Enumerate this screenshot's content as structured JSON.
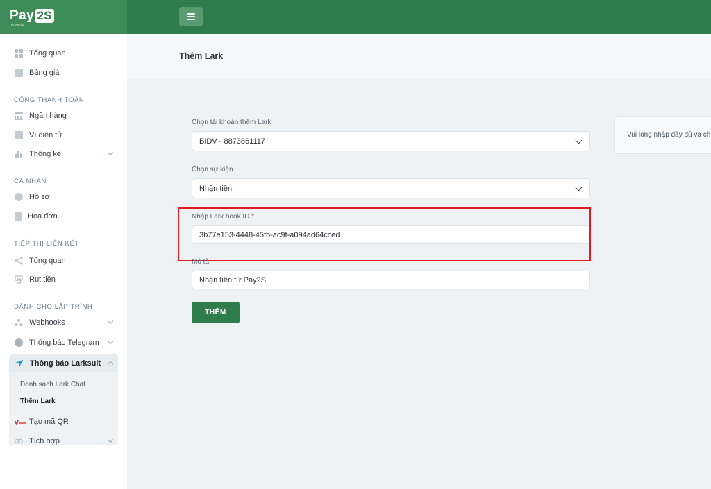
{
  "brand": {
    "name": "Pay",
    "badge": "2S",
    "tagline": "by Web2M"
  },
  "header": {
    "menu_icon": "hamburger-icon"
  },
  "sidebar": {
    "items_top": [
      {
        "label": "Tổng quan",
        "icon": "grid-icon"
      },
      {
        "label": "Bảng giá",
        "icon": "price-tag-icon"
      }
    ],
    "sections": [
      {
        "title": "CỔNG THANH TOÁN",
        "items": [
          {
            "label": "Ngân hàng",
            "icon": "bank-icon"
          },
          {
            "label": "Ví điện tử",
            "icon": "wallet-icon"
          },
          {
            "label": "Thống kê",
            "icon": "chart-icon"
          }
        ]
      },
      {
        "title": "CÁ NHÂN",
        "items": [
          {
            "label": "Hồ sơ",
            "icon": "user-icon"
          },
          {
            "label": "Hoá đơn",
            "icon": "invoice-icon"
          }
        ]
      },
      {
        "title": "TIẾP THỊ LIÊN KẾT",
        "items": [
          {
            "label": "Tổng quan",
            "icon": "network-icon"
          },
          {
            "label": "Rút tiền",
            "icon": "withdraw-icon"
          }
        ]
      },
      {
        "title": "DÀNH CHO LẬP TRÌNH",
        "items": [
          {
            "label": "Webhooks",
            "icon": "webhook-icon"
          },
          {
            "label": "Thông báo Telegram",
            "icon": "telegram-icon"
          },
          {
            "label": "Thông báo Larksuit",
            "icon": "larksuite-icon"
          },
          {
            "label": "Tạo mã QR",
            "icon": "vietqr-icon"
          },
          {
            "label": "Tích hợp",
            "icon": "link-icon"
          }
        ]
      }
    ],
    "lark_submenu": [
      {
        "label": "Danh sách Lark Chat"
      },
      {
        "label": "Thêm Lark"
      }
    ]
  },
  "page": {
    "title": "Thêm Lark"
  },
  "form": {
    "account_label": "Chọn tài khoản thêm Lark",
    "account_value": "BIDV - 8873861117",
    "event_label": "Chọn sự kiện",
    "event_value": "Nhận tiền",
    "hook_label": "Nhập Lark hook ID",
    "required_mark": "*",
    "hook_value": "3b77e153-4448-45fb-ac9f-a094ad64cced",
    "desc_label": "Mô tả",
    "desc_value": "Nhận tiền từ Pay2S",
    "submit_label": "THÊM"
  },
  "info": {
    "text": "Vui lòng nhập đầy đủ và ch"
  },
  "colors": {
    "primary": "#2f7d4a",
    "highlight": "#e21d1d",
    "required": "#e74c3c"
  }
}
